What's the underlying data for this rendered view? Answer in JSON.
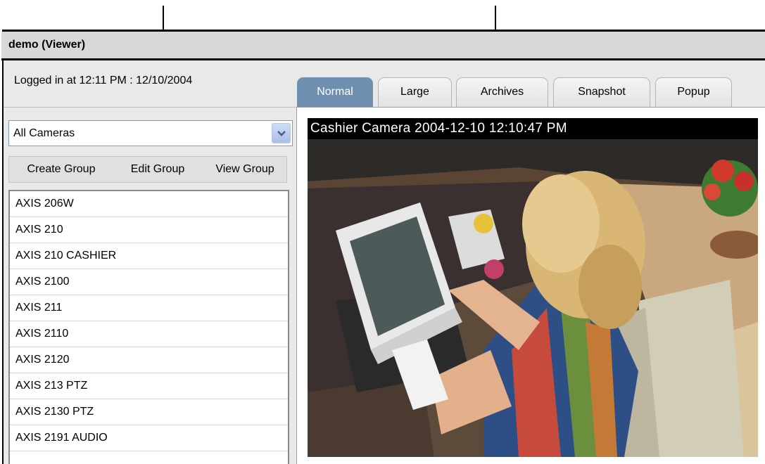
{
  "window": {
    "title": "demo (Viewer)"
  },
  "session": {
    "login_text": "Logged in at 12:11 PM : 12/10/2004"
  },
  "tabs": [
    {
      "label": "Normal",
      "active": true
    },
    {
      "label": "Large",
      "active": false
    },
    {
      "label": "Archives",
      "active": false
    },
    {
      "label": "Snapshot",
      "active": false
    },
    {
      "label": "Popup",
      "active": false
    }
  ],
  "camera_select": {
    "value": "All Cameras"
  },
  "group_buttons": {
    "create": "Create Group",
    "edit": "Edit Group",
    "view": "View Group"
  },
  "camera_list": [
    "AXIS 206W",
    "AXIS 210",
    "AXIS 210 CASHIER",
    "AXIS 2100",
    "AXIS 211",
    "AXIS 2110",
    "AXIS 2120",
    "AXIS 213 PTZ",
    "AXIS 2130 PTZ",
    "AXIS 2191 AUDIO"
  ],
  "camera_view": {
    "caption": "Cashier Camera 2004-12-10 12:10:47 PM"
  },
  "colors": {
    "active_tab": "#6f8fb0",
    "title_bar": "#d8d8d8",
    "select_border": "#7f9db9"
  },
  "icons": {
    "select_arrow": "chevron-down-icon"
  }
}
